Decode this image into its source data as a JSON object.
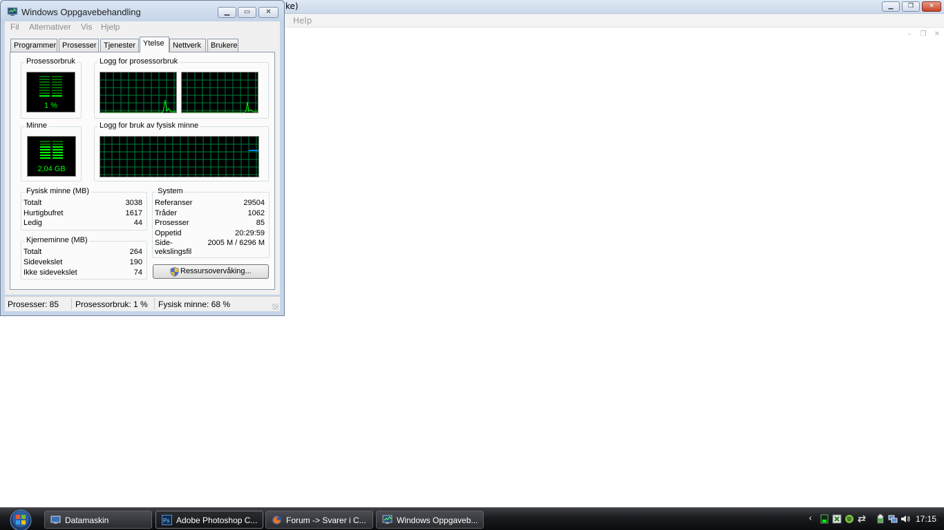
{
  "background_window": {
    "title_fragment": "ke)",
    "menu_help": "Help"
  },
  "task_manager": {
    "title": "Windows Oppgavebehandling",
    "menu": [
      "Fil",
      "Alternativer",
      "Vis",
      "Hjelp"
    ],
    "tabs": [
      "Programmer",
      "Prosesser",
      "Tjenester",
      "Ytelse",
      "Nettverk",
      "Brukere"
    ],
    "active_tab": "Ytelse",
    "cpu_usage": {
      "title": "Prosessorbruk",
      "value": "1 %"
    },
    "cpu_history": {
      "title": "Logg for prosessorbruk"
    },
    "memory": {
      "title": "Minne",
      "value": "2,04 GB"
    },
    "memory_history": {
      "title": "Logg for bruk av fysisk minne"
    },
    "physical_memory": {
      "title": "Fysisk minne (MB)",
      "rows": [
        {
          "label": "Totalt",
          "value": "3038"
        },
        {
          "label": "Hurtigbufret",
          "value": "1617"
        },
        {
          "label": "Ledig",
          "value": "44"
        }
      ]
    },
    "kernel_memory": {
      "title": "Kjerneminne (MB)",
      "rows": [
        {
          "label": "Totalt",
          "value": "264"
        },
        {
          "label": "Sidevekslet",
          "value": "190"
        },
        {
          "label": "Ikke sidevekslet",
          "value": "74"
        }
      ]
    },
    "system": {
      "title": "System",
      "rows": [
        {
          "label": "Referanser",
          "value": "29504"
        },
        {
          "label": "Tråder",
          "value": "1062"
        },
        {
          "label": "Prosesser",
          "value": "85"
        },
        {
          "label": "Oppetid",
          "value": "20:29:59"
        }
      ],
      "pagefile_label_line1": "Side-",
      "pagefile_label_line2": "vekslingsfil",
      "pagefile_value": "2005 M / 6296 M"
    },
    "resource_button": "Ressursovervåking...",
    "status": {
      "processes": "Prosesser: 85",
      "cpu": "Prosessorbruk: 1 %",
      "memory": "Fysisk minne: 68 %"
    }
  },
  "taskbar": {
    "buttons": [
      {
        "label": "Datamaskin",
        "icon": "computer-icon"
      },
      {
        "label": "Adobe Photoshop C...",
        "icon": "photoshop-icon",
        "active": true
      },
      {
        "label": "Forum -> Svarer i C...",
        "icon": "firefox-icon"
      },
      {
        "label": "Windows Oppgaveb...",
        "icon": "task-manager-icon"
      }
    ],
    "clock": "17:15"
  },
  "colors": {
    "graph_grid": "#008040",
    "meter_green": "#00ff00",
    "memory_line": "#0080ff"
  }
}
